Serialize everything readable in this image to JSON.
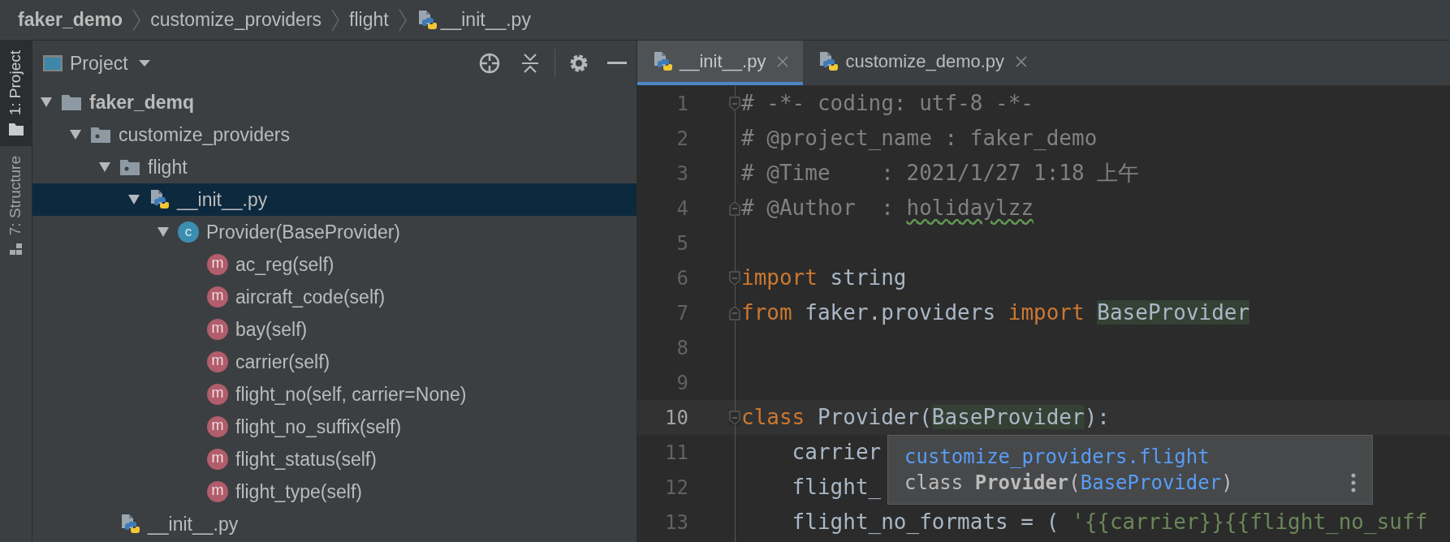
{
  "breadcrumbs": [
    {
      "kind": "project",
      "text": "faker_demo"
    },
    {
      "kind": "folder",
      "text": "customize_providers"
    },
    {
      "kind": "folder",
      "text": "flight"
    },
    {
      "kind": "python_file",
      "text": "__init__.py"
    }
  ],
  "side_tabs": [
    {
      "label": "1: Project",
      "selected": true
    },
    {
      "label": "7: Structure",
      "selected": false
    }
  ],
  "project_panel": {
    "title": "Project"
  },
  "tree": [
    {
      "kind": "root",
      "label": "faker_demq",
      "expanded": true,
      "selected": false,
      "children": [
        {
          "kind": "package",
          "label": "customize_providers",
          "expanded": true,
          "selected": false,
          "children": [
            {
              "kind": "package",
              "label": "flight",
              "expanded": true,
              "selected": false,
              "children": [
                {
                  "kind": "python_file",
                  "label": "__init__.py",
                  "expanded": true,
                  "selected": true,
                  "children": [
                    {
                      "kind": "class",
                      "badge": "c",
                      "label": "Provider(BaseProvider)",
                      "expanded": true,
                      "selected": false,
                      "children": [
                        {
                          "kind": "method",
                          "badge": "m",
                          "label": "ac_reg(self)",
                          "selected": false
                        },
                        {
                          "kind": "method",
                          "badge": "m",
                          "label": "aircraft_code(self)",
                          "selected": false
                        },
                        {
                          "kind": "method",
                          "badge": "m",
                          "label": "bay(self)",
                          "selected": false
                        },
                        {
                          "kind": "method",
                          "badge": "m",
                          "label": "carrier(self)",
                          "selected": false
                        },
                        {
                          "kind": "method",
                          "badge": "m",
                          "label": "flight_no(self, carrier=None)",
                          "selected": false
                        },
                        {
                          "kind": "method",
                          "badge": "m",
                          "label": "flight_no_suffix(self)",
                          "selected": false
                        },
                        {
                          "kind": "method",
                          "badge": "m",
                          "label": "flight_status(self)",
                          "selected": false
                        },
                        {
                          "kind": "method",
                          "badge": "m",
                          "label": "flight_type(self)",
                          "selected": false
                        }
                      ]
                    }
                  ]
                }
              ]
            },
            {
              "kind": "python_file",
              "label": "__init__.py",
              "selected": false
            }
          ]
        }
      ]
    }
  ],
  "editor_tabs": [
    {
      "label": "__init__.py",
      "selected": true
    },
    {
      "label": "customize_demo.py",
      "selected": false
    }
  ],
  "code": [
    {
      "number": "1",
      "current": false,
      "kind": "fold_start",
      "tokens": [
        {
          "kind": "comment",
          "text": "# -*- coding: utf-8 -*-"
        }
      ]
    },
    {
      "number": "2",
      "current": false,
      "tokens": [
        {
          "kind": "comment",
          "text": "# @project_name : faker_demo"
        }
      ]
    },
    {
      "number": "3",
      "current": false,
      "tokens": [
        {
          "kind": "comment",
          "text": "# @Time    : 2021/1/27 1:18 上午"
        }
      ]
    },
    {
      "number": "4",
      "current": false,
      "kind": "fold_end",
      "tokens": [
        {
          "kind": "comment",
          "text": "# @Author  : "
        },
        {
          "kind": "typo",
          "text": "holidaylzz"
        }
      ]
    },
    {
      "number": "5",
      "current": false
    },
    {
      "number": "6",
      "current": false,
      "kind": "fold_start",
      "tokens": [
        {
          "kind": "keyword",
          "text": "import"
        },
        {
          "kind": "plain",
          "text": " string"
        }
      ]
    },
    {
      "number": "7",
      "current": false,
      "kind": "fold_end",
      "tokens": [
        {
          "kind": "keyword",
          "text": "from"
        },
        {
          "kind": "plain",
          "text": " faker.providers "
        },
        {
          "kind": "keyword",
          "text": "import "
        },
        {
          "kind": "match",
          "text": "BaseProvider"
        }
      ]
    },
    {
      "number": "8",
      "current": false
    },
    {
      "number": "9",
      "current": false
    },
    {
      "number": "10",
      "current": true,
      "kind": "fold_start",
      "tokens": [
        {
          "kind": "keyword",
          "text": "class"
        },
        {
          "kind": "plain",
          "text": " Provider("
        },
        {
          "kind": "match",
          "text": "BaseProvider"
        },
        {
          "kind": "plain",
          "text": "):"
        }
      ]
    },
    {
      "number": "11",
      "current": false,
      "tokens": [
        {
          "kind": "plain",
          "text": "    carrier"
        }
      ]
    },
    {
      "number": "12",
      "current": false,
      "tokens": [
        {
          "kind": "plain",
          "text": "    flight_"
        }
      ]
    },
    {
      "number": "13",
      "current": false,
      "tokens": [
        {
          "kind": "plain",
          "text": "    flight_no_formats = ( "
        },
        {
          "kind": "string",
          "text": "'{{carrier}}{{flight_no_suff"
        }
      ]
    }
  ],
  "tooltip": {
    "module": "customize_providers.flight",
    "signature": [
      {
        "kind": "keyword",
        "text": "class "
      },
      {
        "kind": "name",
        "text": "Provider"
      },
      {
        "kind": "plain",
        "text": "("
      },
      {
        "kind": "link",
        "text": "BaseProvider"
      },
      {
        "kind": "plain",
        "text": ")"
      }
    ]
  }
}
